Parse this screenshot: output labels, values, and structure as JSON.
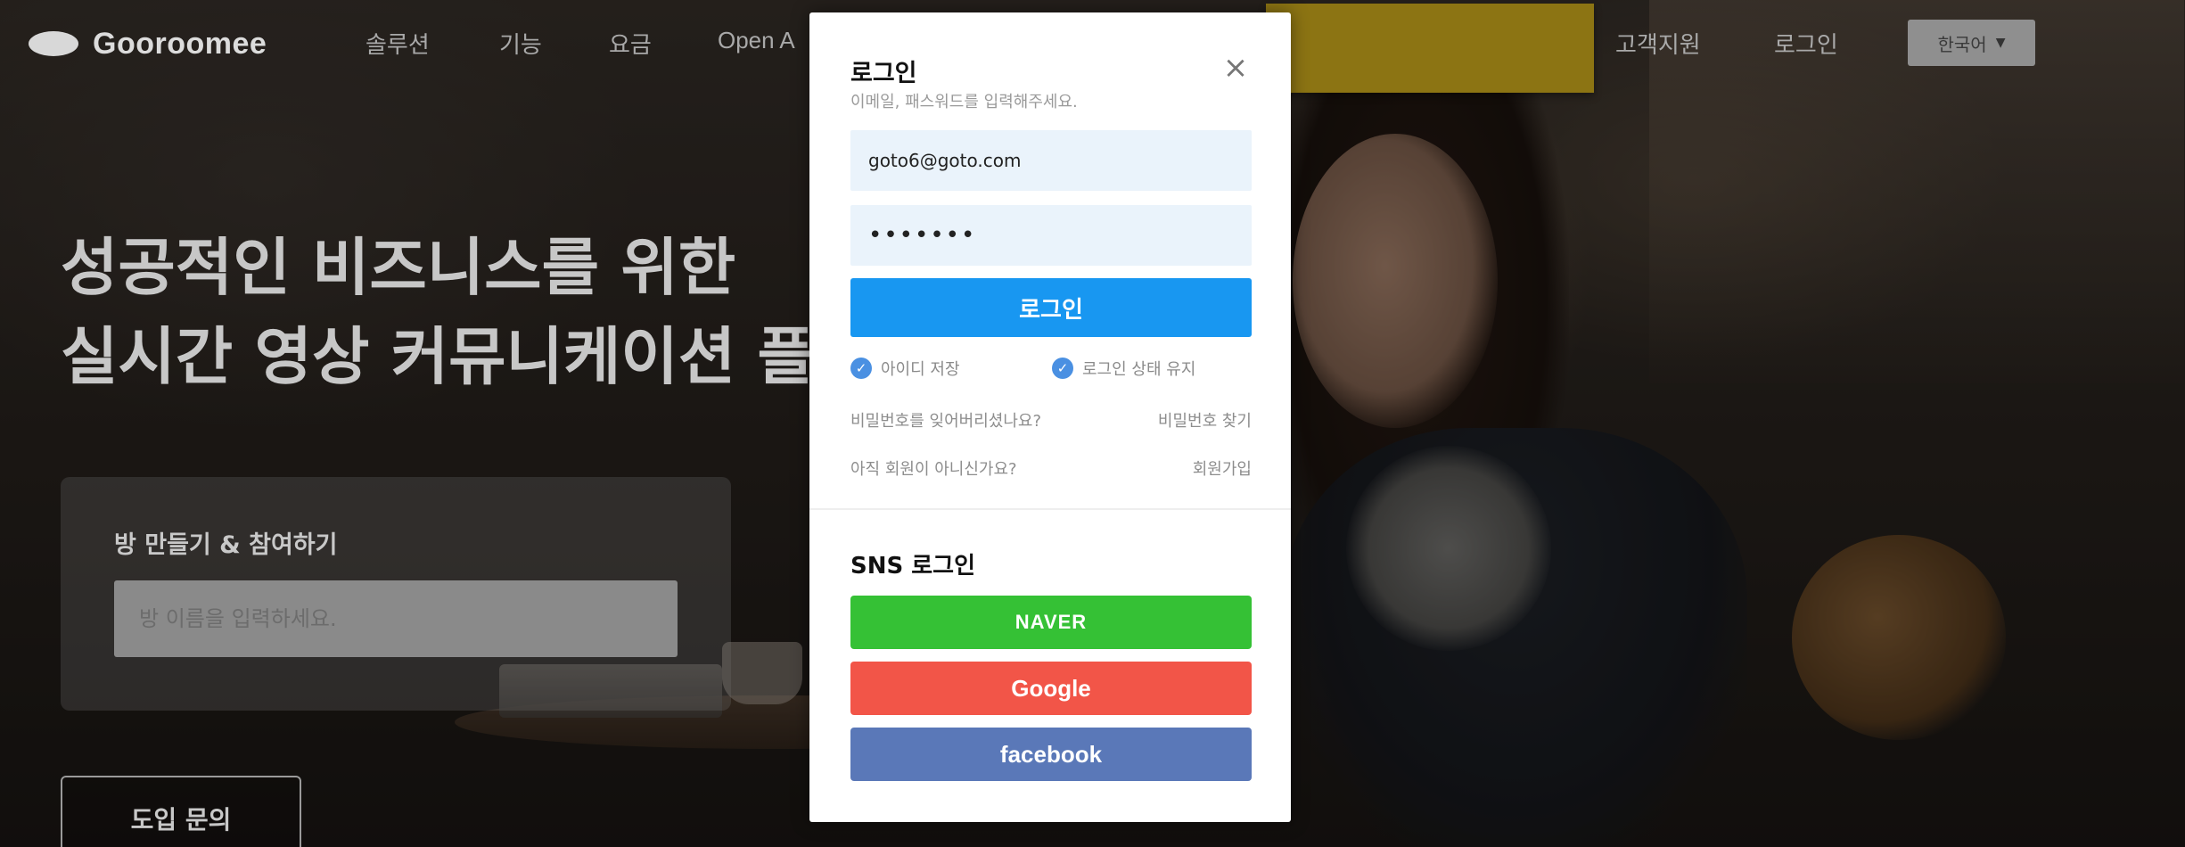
{
  "header": {
    "logo_text": "Gooroomee",
    "nav": [
      "솔루션",
      "기능",
      "요금",
      "Open A"
    ],
    "nav_right": [
      "고객지원",
      "로그인"
    ],
    "language": "한국어"
  },
  "hero": {
    "title_line1": "성공적인 비즈니스를 위한",
    "title_line2": "실시간 영상 커뮤니케이션 플"
  },
  "room": {
    "title": "방 만들기 & 참여하기",
    "placeholder": "방 이름을 입력하세요.",
    "intro_button": "도입 문의"
  },
  "login_modal": {
    "title": "로그인",
    "subtitle": "이메일, 패스워드를 입력해주세요.",
    "close": "×",
    "email_value": "goto6@goto.com",
    "password_value": "•••••••",
    "login_button": "로그인",
    "remember_id": "아이디 저장",
    "keep_logged_in": "로그인 상태 유지",
    "forgot_question": "비밀번호를 잊어버리셨나요?",
    "find_password": "비밀번호 찾기",
    "not_member_question": "아직 회원이 아니신가요?",
    "signup": "회원가입",
    "sns_title": "SNS 로그인",
    "sns": {
      "naver": "NAVER",
      "google": "Google",
      "facebook": "facebook"
    }
  },
  "colors": {
    "login_button": "#1897f1",
    "naver": "#35c135",
    "google": "#f25548",
    "facebook": "#5a78b8",
    "checkbox": "#4a90e2",
    "cta": "#8c7413"
  }
}
